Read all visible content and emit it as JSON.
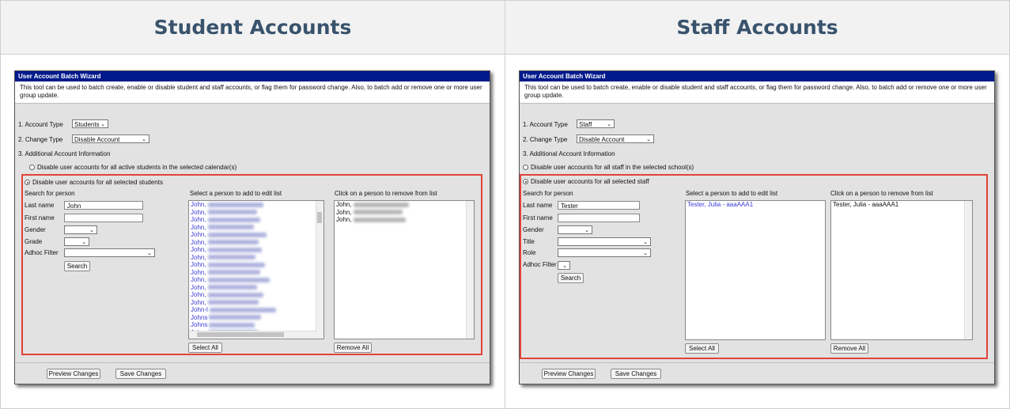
{
  "columns": [
    {
      "heading": "Student Accounts"
    },
    {
      "heading": "Staff Accounts"
    }
  ],
  "student": {
    "title": "User Account Batch Wizard",
    "description": "This tool can be used to batch create, enable or disable student and staff accounts, or flag them for password change. Also, to batch add or remove one or more user group update.",
    "step1_label": "1. Account Type",
    "account_type": "Students",
    "step2_label": "2. Change Type",
    "change_type": "Disable Account",
    "step3_label": "3. Additional Account Information",
    "radio_all": "Disable user accounts for all active students in the selected calendar(s)",
    "radio_selected": "Disable user accounts for all selected students",
    "search_heading": "Search for person",
    "last_name_label": "Last name",
    "last_name_value": "John",
    "first_name_label": "First name",
    "gender_label": "Gender",
    "grade_label": "Grade",
    "adhoc_label": "Adhoc Filter",
    "search_button": "Search",
    "add_heading": "Select a person to add to edit list",
    "remove_heading": "Click on a person to remove from list",
    "results": [
      "John,",
      "John,",
      "John,",
      "John,",
      "John,",
      "John,",
      "John,",
      "John,",
      "John,",
      "John,",
      "John,",
      "John,",
      "John,",
      "John,",
      "John-l",
      "Johns",
      "Johns",
      "Johns"
    ],
    "selected": [
      "John,",
      "John,",
      "John,"
    ],
    "select_all": "Select All",
    "remove_all": "Remove All",
    "preview_button": "Preview Changes",
    "save_button": "Save Changes"
  },
  "staff": {
    "title": "User Account Batch Wizard",
    "description": "This tool can be used to batch create, enable or disable student and staff accounts, or flag them for password change. Also, to batch add or remove one or more user group update.",
    "step1_label": "1. Account Type",
    "account_type": "Staff",
    "step2_label": "2. Change Type",
    "change_type": "Disable Account",
    "step3_label": "3. Additional Account Information",
    "radio_all": "Disable user accounts for all staff in the selected school(s)",
    "radio_selected": "Disable user accounts for all selected staff",
    "search_heading": "Search for person",
    "last_name_label": "Last name",
    "last_name_value": "Tester",
    "first_name_label": "First name",
    "gender_label": "Gender",
    "title_label": "Title",
    "role_label": "Role",
    "adhoc_label": "Adhoc Filter",
    "search_button": "Search",
    "add_heading": "Select a person to add to edit list",
    "remove_heading": "Click on a person to remove from list",
    "results": [
      "Tester, Julia - aaaAAA1"
    ],
    "selected": [
      "Tester, Julia - aaaAAA1"
    ],
    "select_all": "Select All",
    "remove_all": "Remove All",
    "preview_button": "Preview Changes",
    "save_button": "Save Changes"
  },
  "colors": {
    "heading": "#39536d",
    "titlebar": "#001a8c",
    "highlight": "#e0433c",
    "link": "#3b3bd8"
  }
}
